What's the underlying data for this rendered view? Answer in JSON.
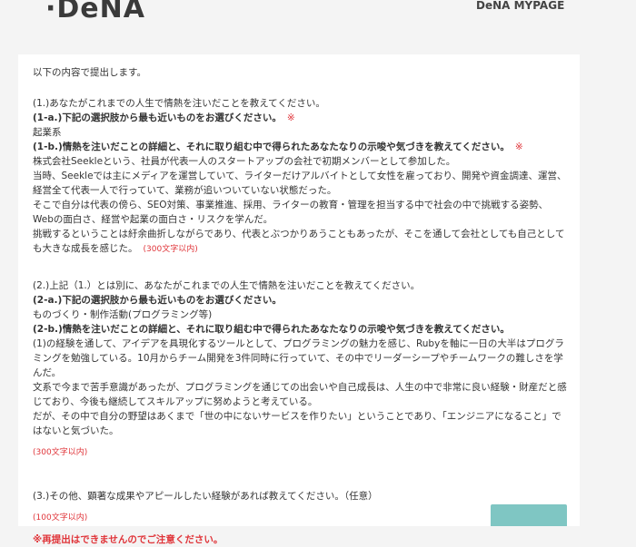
{
  "header": {
    "logo_text": "·DeNA",
    "mypage_label": "DeNA MYPAGE"
  },
  "form": {
    "intro": "以下の内容で提出します。",
    "q1": {
      "title": "(1.)あなたがこれまでの人生で情熱を注いだことを教えてください。",
      "a_label": "(1-a.)下記の選択肢から最も近いものをお選びください。",
      "a_required": "※",
      "a_value": "起業系",
      "b_label": "(1-b.)情熱を注いだことの詳細と、それに取り組む中で得られたあなたなりの示唆や気づきを教えてください。",
      "b_required": "※",
      "b_lines": [
        "株式会社Seekleという、社員が代表一人のスタートアップの会社で初期メンバーとして参加した。",
        "当時、Seekleでは主にメディアを運営していて、ライターだけアルバイトとして女性を雇っており、開発や資金調達、運営、経営全て代表一人で行っていて、業務が追いついていない状態だった。",
        "そこで自分は代表の傍ら、SEO対策、事業推進、採用、ライターの教育・管理を担当する中で社会の中で挑戦する姿勢、Webの面白さ、経営や起業の面白さ・リスクを学んだ。",
        "挑戦するということは紆余曲折しながらであり、代表とぶつかりあうこともあったが、そこを通して会社としても自己としても大きな成長を感じた。"
      ],
      "b_limit": "(300文字以内)"
    },
    "q2": {
      "title": "(2.)上記（1.）とは別に、あなたがこれまでの人生で情熱を注いだことを教えてください。",
      "a_label": "(2-a.)下記の選択肢から最も近いものをお選びください。",
      "a_value": "ものづくり・制作活動(プログラミング等)",
      "b_label": "(2-b.)情熱を注いだことの詳細と、それに取り組む中で得られたあなたなりの示唆や気づきを教えてください。",
      "b_lines": [
        "(1)の経験を通して、アイデアを具現化するツールとして、プログラミングの魅力を感じ、Rubyを軸に一日の大半はプログラミングを勉強している。10月からチーム開発を3件同時に行っていて、その中でリーダーシープやチームワークの難しさを学んだ。",
        "文系で今まで苦手意識があったが、プログラミングを通じての出会いや自己成長は、人生の中で非常に良い経験・財産だと感じており、今後も継続してスキルアップに努めようと考えている。",
        "だが、その中で自分の野望はあくまで「世の中にないサービスを作りたい」ということであり、「エンジニアになること」ではないと気づいた。"
      ],
      "b_limit": "(300文字以内)"
    },
    "q3": {
      "title": "(3.)その他、顕著な成果やアピールしたい経験があれば教えてください。（任意）",
      "limit": "(100文字以内)",
      "warning": "※再提出はできませんのでご注意ください。"
    }
  },
  "colors": {
    "required": "#e0353a",
    "submit_button": "#7fc6c3",
    "card": "#ffffff",
    "background": "#f4f4f4"
  }
}
